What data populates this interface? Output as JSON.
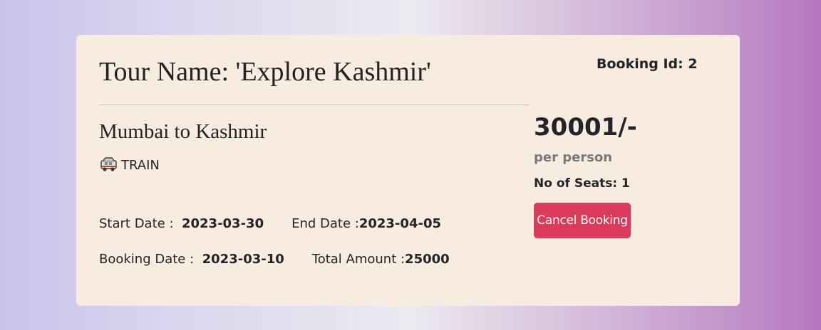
{
  "booking": {
    "tour_name": "Tour Name: 'Explore Kashmir'",
    "booking_id": "Booking Id: 2",
    "route": "Mumbai to Kashmir",
    "transport": {
      "icon": "car-icon",
      "label": "TRAIN"
    },
    "start_date_label": "Start Date :",
    "start_date": "2023-03-30",
    "end_date_label": "End Date :",
    "end_date": "2023-04-05",
    "booking_date_label": "Booking Date :",
    "booking_date": "2023-03-10",
    "total_amount_label": "Total Amount :",
    "total_amount": "25000",
    "price": "30001/-",
    "price_unit": "per person",
    "seats": "No of Seats: 1",
    "cancel_label": "Cancel Booking"
  },
  "colors": {
    "card_background": "#f8ebdf",
    "cancel_button": "#dc3a5a",
    "muted_text": "#7a7a7a"
  }
}
